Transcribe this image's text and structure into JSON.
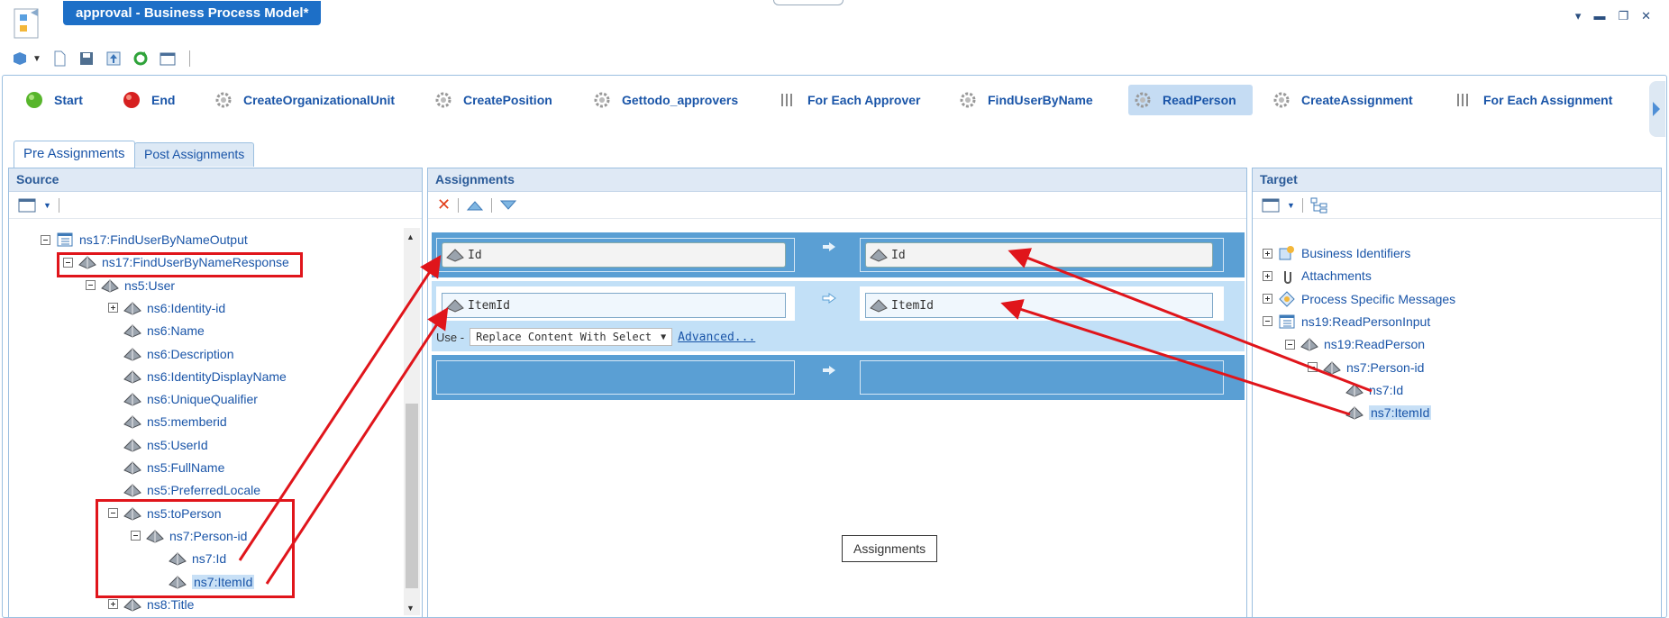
{
  "window": {
    "title": "approval - Business Process Model*"
  },
  "palette": [
    {
      "label": "Start",
      "icon": "start-circle-icon"
    },
    {
      "label": "End",
      "icon": "end-circle-icon"
    },
    {
      "label": "CreateOrganizationalUnit",
      "icon": "gear-icon"
    },
    {
      "label": "CreatePosition",
      "icon": "gear-icon"
    },
    {
      "label": "Gettodo_approvers",
      "icon": "gear-icon"
    },
    {
      "label": "For Each Approver",
      "icon": "loop-icon"
    },
    {
      "label": "FindUserByName",
      "icon": "gear-icon"
    },
    {
      "label": "ReadPerson",
      "icon": "gear-icon",
      "selected": true
    },
    {
      "label": "CreateAssignment",
      "icon": "gear-icon"
    },
    {
      "label": "For Each Assignment",
      "icon": "loop-icon"
    }
  ],
  "tabs": [
    "Pre Assignments",
    "Post Assignments"
  ],
  "panels": {
    "source": "Source",
    "assignments": "Assignments",
    "target": "Target"
  },
  "source_tree": [
    {
      "label": "ns17:FindUserByNameOutput",
      "level": 0,
      "exp": "minus",
      "icon": "table"
    },
    {
      "label": "ns17:FindUserByNameResponse",
      "level": 1,
      "exp": "minus",
      "icon": "gem"
    },
    {
      "label": "ns5:User",
      "level": 2,
      "exp": "minus",
      "icon": "gem"
    },
    {
      "label": "ns6:Identity-id",
      "level": 3,
      "exp": "plus",
      "icon": "gem"
    },
    {
      "label": "ns6:Name",
      "level": 3,
      "icon": "gem"
    },
    {
      "label": "ns6:Description",
      "level": 3,
      "icon": "gem"
    },
    {
      "label": "ns6:IdentityDisplayName",
      "level": 3,
      "icon": "gem"
    },
    {
      "label": "ns6:UniqueQualifier",
      "level": 3,
      "icon": "gem"
    },
    {
      "label": "ns5:memberid",
      "level": 3,
      "icon": "gem"
    },
    {
      "label": "ns5:UserId",
      "level": 3,
      "icon": "gem"
    },
    {
      "label": "ns5:FullName",
      "level": 3,
      "icon": "gem"
    },
    {
      "label": "ns5:PreferredLocale",
      "level": 3,
      "icon": "gem"
    },
    {
      "label": "ns5:toPerson",
      "level": 3,
      "exp": "minus",
      "icon": "gem"
    },
    {
      "label": "ns7:Person-id",
      "level": 4,
      "exp": "minus",
      "icon": "gem"
    },
    {
      "label": "ns7:Id",
      "level": 5,
      "icon": "gem"
    },
    {
      "label": "ns7:ItemId",
      "level": 5,
      "icon": "gem",
      "highlight": true
    },
    {
      "label": "ns8:Title",
      "level": 3,
      "exp": "plus",
      "icon": "gem"
    }
  ],
  "assignments": {
    "rows": [
      {
        "source": "Id",
        "target": "Id"
      },
      {
        "source": "ItemId",
        "target": "ItemId"
      }
    ],
    "use_label": "Use -",
    "use_option": "Replace Content With Select",
    "advanced_link": "Advanced...",
    "tooltip": "Assignments"
  },
  "target_tree": [
    {
      "label": "Business Identifiers",
      "level": 0,
      "exp": "plus",
      "icon": "identifiers"
    },
    {
      "label": "Attachments",
      "level": 0,
      "exp": "plus",
      "icon": "paperclip"
    },
    {
      "label": "Process Specific Messages",
      "level": 0,
      "exp": "plus",
      "icon": "message"
    },
    {
      "label": "ns19:ReadPersonInput",
      "level": 0,
      "exp": "minus",
      "icon": "table"
    },
    {
      "label": "ns19:ReadPerson",
      "level": 1,
      "exp": "minus",
      "icon": "gem"
    },
    {
      "label": "ns7:Person-id",
      "level": 2,
      "exp": "minus",
      "icon": "gem"
    },
    {
      "label": "ns7:Id",
      "level": 3,
      "icon": "gem"
    },
    {
      "label": "ns7:ItemId",
      "level": 3,
      "icon": "gem",
      "highlight": true
    }
  ],
  "colors": {
    "accent": "#1d6fc7",
    "annotation": "#e0151b",
    "row": "#5a9fd4"
  }
}
